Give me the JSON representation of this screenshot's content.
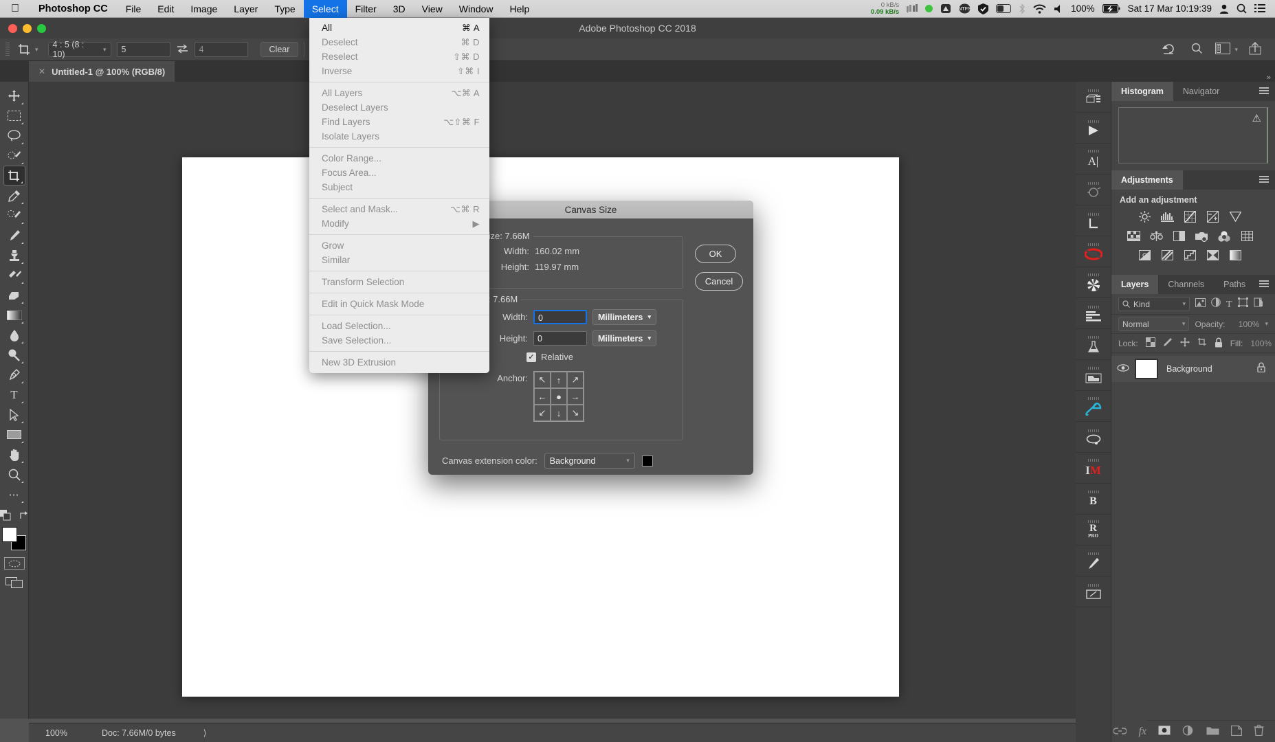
{
  "macbar": {
    "apple_icon": "apple-icon",
    "app_name": "Photoshop CC",
    "menus": [
      "File",
      "Edit",
      "Image",
      "Layer",
      "Type",
      "Select",
      "Filter",
      "3D",
      "View",
      "Window",
      "Help"
    ],
    "active_menu": "Select",
    "net_up": "0 kB/s",
    "net_down": "0.09 kB/s",
    "battery_percent": "100%",
    "datetime": "Sat 17 Mar  10:19:39",
    "accent_blue": "#1473e6"
  },
  "titlebar": {
    "title": "Adobe Photoshop CC 2018"
  },
  "options_bar": {
    "tool_icon": "crop-tool-icon",
    "ratio_preset": "4 : 5 (8 : 10)",
    "width_value": "5",
    "height_value": "4",
    "swap_icon": "swap-arrows-icon",
    "clear_label": "Clear",
    "reset_icon": "reset-arrow-icon",
    "search_icon": "search-icon",
    "workspace_icon": "workspace-icon",
    "share_icon": "share-icon"
  },
  "document_tab": {
    "close_icon": "close-icon",
    "label": "Untitled-1 @ 100% (RGB/8)"
  },
  "toolbox": [
    {
      "name": "move-tool",
      "glyph": "✥"
    },
    {
      "name": "rectangular-marquee-tool",
      "glyph": "▭"
    },
    {
      "name": "lasso-tool",
      "glyph": "◯"
    },
    {
      "name": "quick-selection-tool",
      "glyph": "✺"
    },
    {
      "name": "crop-tool",
      "glyph": "⌗"
    },
    {
      "name": "eyedropper-tool",
      "glyph": "⌇"
    },
    {
      "name": "spot-healing-brush-tool",
      "glyph": "✣"
    },
    {
      "name": "brush-tool",
      "glyph": "✎"
    },
    {
      "name": "clone-stamp-tool",
      "glyph": "⌸"
    },
    {
      "name": "history-brush-tool",
      "glyph": "✧"
    },
    {
      "name": "eraser-tool",
      "glyph": "◣"
    },
    {
      "name": "gradient-tool",
      "glyph": "▤"
    },
    {
      "name": "blur-tool",
      "glyph": "◓"
    },
    {
      "name": "dodge-tool",
      "glyph": "⚲"
    },
    {
      "name": "pen-tool",
      "glyph": "✒"
    },
    {
      "name": "type-tool",
      "glyph": "T"
    },
    {
      "name": "path-selection-tool",
      "glyph": "➤"
    },
    {
      "name": "rectangle-tool",
      "glyph": "▭"
    },
    {
      "name": "hand-tool",
      "glyph": "✋"
    },
    {
      "name": "zoom-tool",
      "glyph": "⌕"
    },
    {
      "name": "edit-toolbar-tool",
      "glyph": "•••"
    }
  ],
  "statusbar": {
    "zoom": "100%",
    "doc_info": "Doc: 7.66M/0 bytes",
    "expand_icon": "chevron-right-icon"
  },
  "select_menu": {
    "groups": [
      [
        {
          "label": "All",
          "shortcut": "⌘ A",
          "enabled": true
        },
        {
          "label": "Deselect",
          "shortcut": "⌘ D",
          "enabled": false
        },
        {
          "label": "Reselect",
          "shortcut": "⇧⌘ D",
          "enabled": false
        },
        {
          "label": "Inverse",
          "shortcut": "⇧⌘ I",
          "enabled": false
        }
      ],
      [
        {
          "label": "All Layers",
          "shortcut": "⌥⌘ A",
          "enabled": false
        },
        {
          "label": "Deselect Layers",
          "shortcut": "",
          "enabled": false
        },
        {
          "label": "Find Layers",
          "shortcut": "⌥⇧⌘ F",
          "enabled": false
        },
        {
          "label": "Isolate Layers",
          "shortcut": "",
          "enabled": false
        }
      ],
      [
        {
          "label": "Color Range...",
          "shortcut": "",
          "enabled": false
        },
        {
          "label": "Focus Area...",
          "shortcut": "",
          "enabled": false
        },
        {
          "label": "Subject",
          "shortcut": "",
          "enabled": false
        }
      ],
      [
        {
          "label": "Select and Mask...",
          "shortcut": "⌥⌘ R",
          "enabled": false
        },
        {
          "label": "Modify",
          "shortcut": "▶",
          "enabled": false
        }
      ],
      [
        {
          "label": "Grow",
          "shortcut": "",
          "enabled": false
        },
        {
          "label": "Similar",
          "shortcut": "",
          "enabled": false
        }
      ],
      [
        {
          "label": "Transform Selection",
          "shortcut": "",
          "enabled": false
        }
      ],
      [
        {
          "label": "Edit in Quick Mask Mode",
          "shortcut": "",
          "enabled": false
        }
      ],
      [
        {
          "label": "Load Selection...",
          "shortcut": "",
          "enabled": false
        },
        {
          "label": "Save Selection...",
          "shortcut": "",
          "enabled": false
        }
      ],
      [
        {
          "label": "New 3D Extrusion",
          "shortcut": "",
          "enabled": false
        }
      ]
    ]
  },
  "canvas_size_dialog": {
    "title": "Canvas Size",
    "current_size_legend": "Current Size: 7.66M",
    "current_width_label": "Width:",
    "current_width_value": "160.02 mm",
    "current_height_label": "Height:",
    "current_height_value": "119.97 mm",
    "new_size_legend": "New Size: 7.66M",
    "new_width_label": "Width:",
    "new_width_value": "0",
    "new_width_unit": "Millimeters",
    "new_height_label": "Height:",
    "new_height_value": "0",
    "new_height_unit": "Millimeters",
    "relative_label": "Relative",
    "relative_checked": true,
    "anchor_label": "Anchor:",
    "anchor_cells": [
      "↖",
      "↑",
      "↗",
      "←",
      "●",
      "→",
      "↙",
      "↓",
      "↘"
    ],
    "extension_color_label": "Canvas extension color:",
    "extension_color_value": "Background",
    "extension_swatch": "#000000",
    "ok_label": "OK",
    "cancel_label": "Cancel"
  },
  "panels": {
    "histogram": {
      "tabs": [
        "Histogram",
        "Navigator"
      ],
      "active": "Histogram",
      "warning_icon": "warning-triangle-icon"
    },
    "adjustments": {
      "tab": "Adjustments",
      "subtitle": "Add an adjustment",
      "rows": [
        [
          {
            "name": "brightness-contrast-icon",
            "glyph": "☀"
          },
          {
            "name": "levels-icon",
            "glyph": "▥"
          },
          {
            "name": "curves-icon",
            "glyph": "▨"
          },
          {
            "name": "exposure-icon",
            "glyph": "◲"
          },
          {
            "name": "vibrance-icon",
            "glyph": "▽"
          }
        ],
        [
          {
            "name": "hue-saturation-icon",
            "glyph": "▦"
          },
          {
            "name": "color-balance-icon",
            "glyph": "⚖"
          },
          {
            "name": "black-white-icon",
            "glyph": "◧"
          },
          {
            "name": "photo-filter-icon",
            "glyph": "◉"
          },
          {
            "name": "channel-mixer-icon",
            "glyph": "❂"
          },
          {
            "name": "color-lookup-icon",
            "glyph": "▦"
          }
        ],
        [
          {
            "name": "invert-icon",
            "glyph": "◪"
          },
          {
            "name": "posterize-icon",
            "glyph": "▨"
          },
          {
            "name": "threshold-icon",
            "glyph": "▩"
          },
          {
            "name": "selective-color-icon",
            "glyph": "⧗"
          },
          {
            "name": "gradient-map-icon",
            "glyph": "▬"
          }
        ]
      ]
    },
    "layers": {
      "tabs": [
        "Layers",
        "Channels",
        "Paths"
      ],
      "active": "Layers",
      "filter_label": "Kind",
      "filter_icons": [
        "pixel-filter-icon",
        "adjustment-filter-icon",
        "type-filter-icon",
        "shape-filter-icon",
        "smart-object-filter-icon"
      ],
      "blend_mode": "Normal",
      "opacity_label": "Opacity:",
      "opacity_value": "100%",
      "lock_label": "Lock:",
      "lock_icons": [
        "lock-transparent-pixels-icon",
        "lock-image-pixels-icon",
        "lock-position-icon",
        "lock-artboard-icon",
        "lock-all-icon"
      ],
      "fill_label": "Fill:",
      "fill_value": "100%",
      "rows": [
        {
          "visible_icon": "eye-icon",
          "name": "Background",
          "locked_icon": "lock-icon"
        }
      ],
      "footer_icons": [
        "link-layers-icon",
        "layer-style-fx-icon",
        "layer-mask-icon",
        "new-fill-adjustment-icon",
        "new-group-icon",
        "new-layer-icon",
        "delete-layer-icon"
      ]
    },
    "rail": [
      {
        "name": "3d-panel-icon",
        "glyph": "▣"
      },
      {
        "name": "timeline-play-icon",
        "glyph": "▶"
      },
      {
        "name": "character-panel-icon",
        "glyph": "A"
      },
      {
        "name": "measurement-icon",
        "glyph": "✺"
      },
      {
        "name": "notes-icon",
        "glyph": "L"
      },
      {
        "name": "red-plugin-icon",
        "glyph": "◉"
      },
      {
        "name": "aperture-plugin-icon",
        "glyph": "❂"
      },
      {
        "name": "histogram-bars-icon",
        "glyph": "▤"
      },
      {
        "name": "flask-icon",
        "glyph": "⚗"
      },
      {
        "name": "folder-icon",
        "glyph": "▰"
      },
      {
        "name": "umbrella-icon",
        "glyph": "☂"
      },
      {
        "name": "lasso-plugin-icon",
        "glyph": "◯"
      },
      {
        "name": "im-plugin-icon",
        "glyph": "M"
      },
      {
        "name": "b-plugin-icon",
        "glyph": "B"
      },
      {
        "name": "r-pro-plugin-icon",
        "glyph": "R"
      },
      {
        "name": "brush-plugin-icon",
        "glyph": "✎"
      },
      {
        "name": "tablet-plugin-icon",
        "glyph": "▱"
      }
    ],
    "collapse_icon": "collapse-panels-icon"
  }
}
